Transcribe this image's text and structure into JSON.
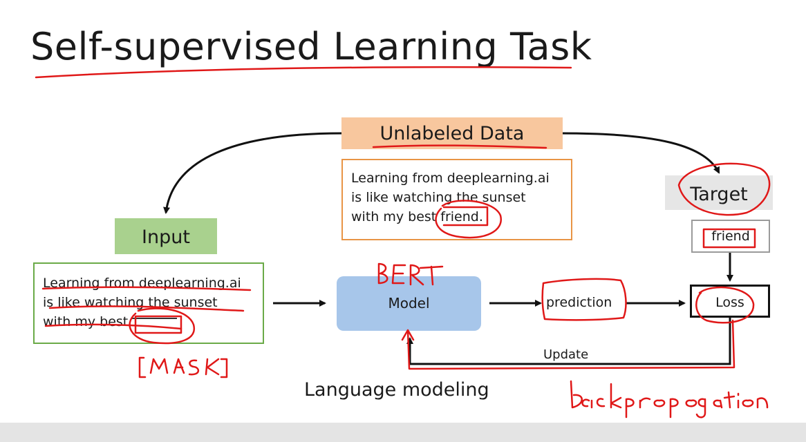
{
  "title": "Self-supervised Learning Task",
  "unlabeled": {
    "label": "Unlabeled Data",
    "lines": [
      "Learning from deeplearning.ai",
      "is like watching the sunset",
      "with my best friend."
    ]
  },
  "input": {
    "label": "Input",
    "lines": [
      "Learning from deeplearning.ai",
      "is like watching the sunset",
      "with my best"
    ]
  },
  "target": {
    "label": "Target",
    "word": "friend"
  },
  "model": {
    "label": "Model"
  },
  "prediction": {
    "label": "prediction"
  },
  "loss": {
    "label": "Loss"
  },
  "update": {
    "label": "Update"
  },
  "language_modeling": "Language modeling",
  "annotations": {
    "bert": "BERT",
    "mask": "[MASK]",
    "backprop": "backpropagation"
  },
  "colors": {
    "unlabeled_fill": "#f8c79e",
    "unlabeled_border": "#e89445",
    "input_fill": "#a9d18e",
    "input_border": "#6aaa47",
    "model_fill": "#a7c6ea",
    "target_fill": "#e6e6e6",
    "pen_red": "#e01818"
  }
}
